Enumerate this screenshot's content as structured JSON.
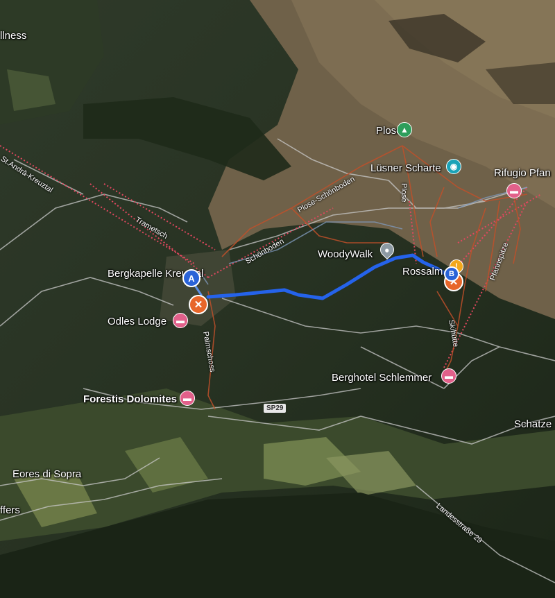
{
  "map": {
    "places": {
      "wellness": "llness",
      "plose": "Plose",
      "lusner_scharte": "Lüsner Scharte",
      "rifugio": "Rifugio Pfan",
      "woodywalk": "WoodyWalk",
      "rossalm": "Rossalm",
      "bergkapelle": "Bergkapelle Kreuztal",
      "odles_lodge": "Odles Lodge",
      "forestis": "Forestis Dolomites",
      "berghotel": "Berghotel Schlemmer",
      "schatze": "Schatze",
      "eores": "Eores di Sopra",
      "ffers": "ffers"
    },
    "trails": {
      "st_andra": "St.Andrä-Kreuztal",
      "trametsch": "Trametsch",
      "plose_schonboden": "Plose-Schönboden",
      "schonboden": "Schönboden",
      "plose_vertical": "Plose",
      "pfannspitze": "Pfannspitze",
      "skihutte": "Skihütte",
      "palmschoss": "Palmschoss"
    },
    "roads": {
      "sp29": "SP29",
      "landesstrasse": "Landesstraße 29"
    },
    "markers": {
      "start": "A",
      "end": "B"
    },
    "icons": {
      "hotel": "hotel-icon",
      "peak": "mountain-peak-icon",
      "camera": "camera-icon",
      "restaurant": "restaurant-icon"
    },
    "colors": {
      "route": "#2563eb",
      "ski_trail": "#c1502a",
      "lift": "#e1485f",
      "hotel": "#e2608a",
      "food": "#e7662a"
    }
  }
}
